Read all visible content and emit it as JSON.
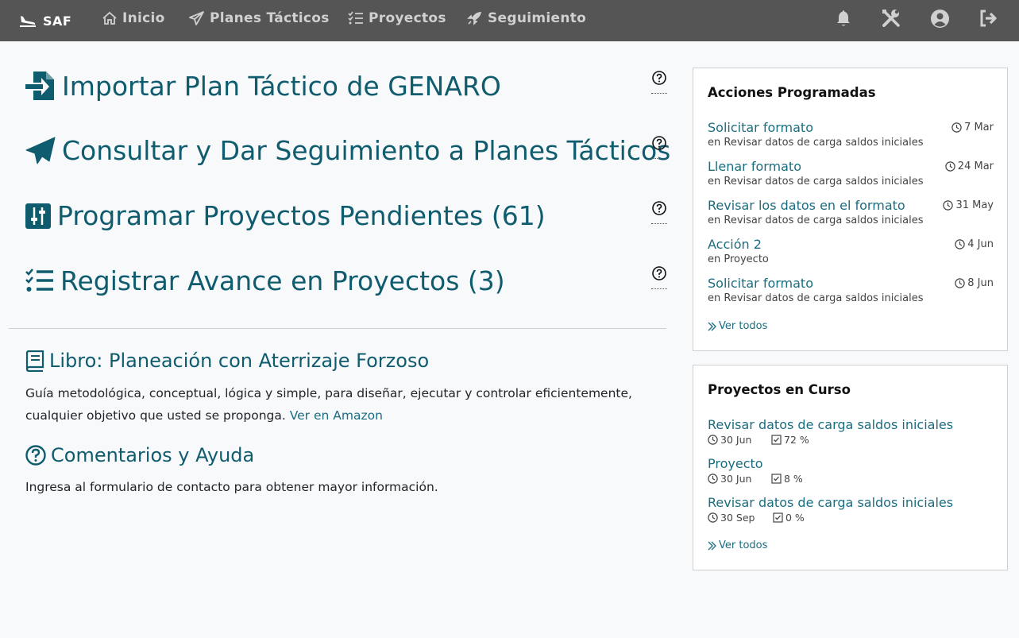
{
  "nav": {
    "brand": "SAF",
    "items": [
      {
        "label": "Inicio",
        "icon": "home-icon"
      },
      {
        "label": "Planes Tácticos",
        "icon": "paper-plane-icon"
      },
      {
        "label": "Proyectos",
        "icon": "checklist-icon"
      },
      {
        "label": "Seguimiento",
        "icon": "rocket-icon"
      }
    ],
    "right_icons": [
      "bell-icon",
      "tools-icon",
      "user-icon",
      "logout-icon"
    ]
  },
  "actions": [
    {
      "label": "Importar Plan Táctico de GENARO",
      "icon": "file-import-icon"
    },
    {
      "label": "Consultar y Dar Seguimiento a Planes Tácticos",
      "icon": "paper-plane-icon"
    },
    {
      "label": "Programar Proyectos Pendientes (61)",
      "icon": "sliders-icon"
    },
    {
      "label": "Registrar Avance en Proyectos (3)",
      "icon": "checklist-icon"
    }
  ],
  "book": {
    "title": "Libro: Planeación con Aterrizaje Forzoso",
    "text": "Guía metodológica, conceptual, lógica y simple, para diseñar, ejecutar y controlar eficientemente, cualquier objetivo que usted se proponga.",
    "link": "Ver en Amazon"
  },
  "help": {
    "title": "Comentarios y Ayuda",
    "text": "Ingresa al formulario de contacto para obtener mayor información."
  },
  "scheduled": {
    "title": "Acciones Programadas",
    "items": [
      {
        "title": "Solicitar formato",
        "sub": "en Revisar datos de carga saldos iniciales",
        "date": "7 Mar"
      },
      {
        "title": "Llenar formato",
        "sub": "en Revisar datos de carga saldos iniciales",
        "date": "24 Mar"
      },
      {
        "title": "Revisar los datos en el formato",
        "sub": "en Revisar datos de carga saldos iniciales",
        "date": "31 May"
      },
      {
        "title": "Acción 2",
        "sub": "en Proyecto",
        "date": "4 Jun"
      },
      {
        "title": "Solicitar formato",
        "sub": "en Revisar datos de carga saldos iniciales",
        "date": "8 Jun"
      }
    ],
    "see_all": "Ver todos"
  },
  "projects": {
    "title": "Proyectos en Curso",
    "items": [
      {
        "title": "Revisar datos de carga saldos iniciales",
        "date": "30 Jun",
        "progress": "72 %"
      },
      {
        "title": "Proyecto",
        "date": "30 Jun",
        "progress": "8 %"
      },
      {
        "title": "Revisar datos de carga saldos iniciales",
        "date": "30 Sep",
        "progress": "0 %"
      }
    ],
    "see_all": "Ver todos"
  },
  "colors": {
    "navbar": "#555555",
    "accent": "#0f5c6e",
    "link": "#1b6d80"
  }
}
